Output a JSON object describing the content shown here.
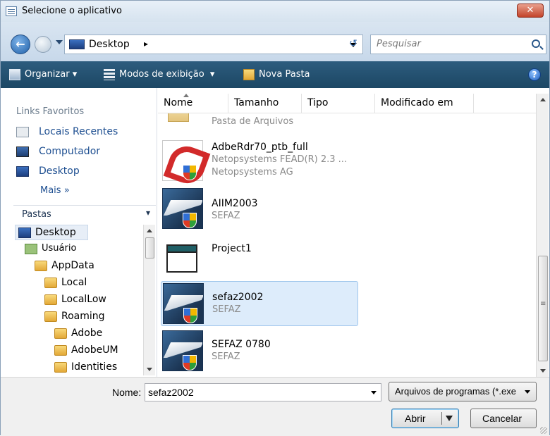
{
  "window": {
    "title": "Selecione o aplicativo",
    "close_label": "✕"
  },
  "address": {
    "location": "Desktop",
    "chevron": "▸",
    "search_placeholder": "Pesquisar",
    "refresh_glyph": "↺"
  },
  "toolbar": {
    "organize": "Organizar",
    "views": "Modos de exibição",
    "new_folder": "Nova Pasta",
    "help": "?"
  },
  "favorites": {
    "heading": "Links Favoritos",
    "items": [
      "Locais Recentes",
      "Computador",
      "Desktop"
    ],
    "more": "Mais »"
  },
  "folders": {
    "label": "Pastas",
    "tree": [
      "Desktop",
      "Usuário",
      "AppData",
      "Local",
      "LocalLow",
      "Roaming",
      "Adobe",
      "AdobeUM",
      "Identities"
    ]
  },
  "columns": [
    "Nome",
    "Tamanho",
    "Tipo",
    "Modificado em"
  ],
  "files": [
    {
      "name": "Pasta de Arquivos",
      "lines": []
    },
    {
      "name": "AdbeRdr70_ptb_full",
      "lines": [
        "Netopsystems FEAD(R) 2.3 ...",
        "Netopsystems AG"
      ]
    },
    {
      "name": "AIIM2003",
      "lines": [
        "SEFAZ"
      ]
    },
    {
      "name": "Project1",
      "lines": []
    },
    {
      "name": "sefaz2002",
      "lines": [
        "SEFAZ"
      ]
    },
    {
      "name": "SEFAZ 0780",
      "lines": [
        "SEFAZ"
      ]
    }
  ],
  "bottom": {
    "name_label": "Nome:",
    "name_value": "sefaz2002",
    "filter": "Arquivos de programas (*.exe",
    "open": "Abrir",
    "cancel": "Cancelar"
  },
  "colors": {
    "toolbar": "#1c4764",
    "link": "#1e4f91",
    "selection": "#ddecfb"
  }
}
